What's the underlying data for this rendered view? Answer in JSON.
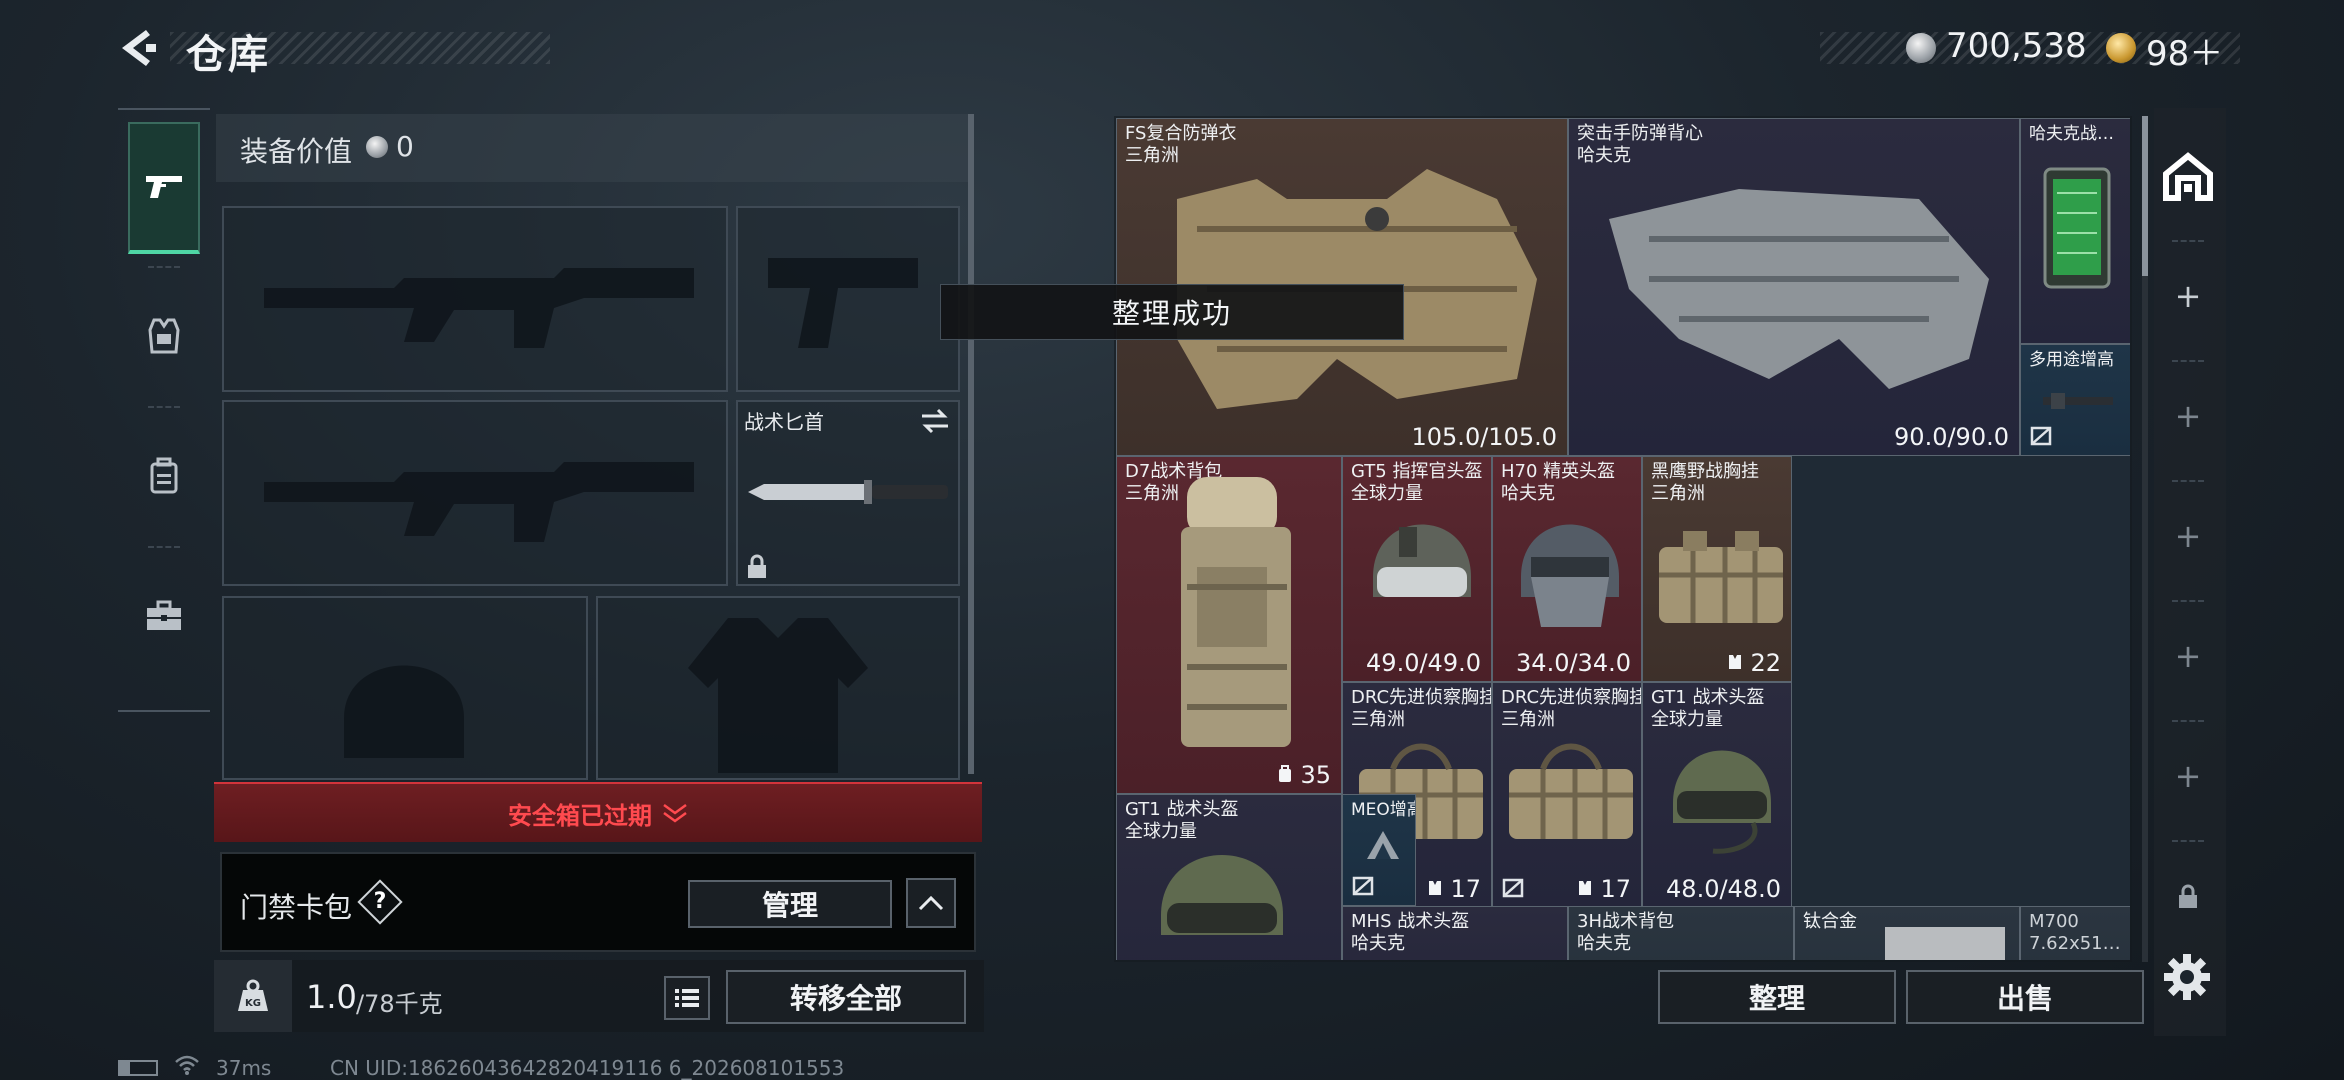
{
  "header": {
    "title": "仓库",
    "silver_amount": "700,538",
    "gold_amount": "98＋"
  },
  "sidenav": {
    "items": [
      {
        "icon": "pistol-icon",
        "active": true
      },
      {
        "icon": "armor-vest-icon",
        "active": false
      },
      {
        "icon": "backpack-icon",
        "active": false
      },
      {
        "icon": "briefcase-icon",
        "active": false
      }
    ]
  },
  "equipment": {
    "value_label": "装备价值",
    "value": "0",
    "knife_label": "战术匕首"
  },
  "safebox": {
    "warning": "安全箱已过期"
  },
  "keycard": {
    "label": "门禁卡包",
    "help": "?",
    "manage_label": "管理"
  },
  "weight": {
    "current": "1.0",
    "max": "/78千克",
    "transfer_label": "转移全部"
  },
  "toast": "整理成功",
  "grid": {
    "items": [
      {
        "name": "FS复合防弹衣",
        "sub": "三角洲",
        "value": "105.0/105.0"
      },
      {
        "name": "突击手防弹背心",
        "sub": "哈夫克",
        "value": "90.0/90.0"
      },
      {
        "name": "哈夫克战…",
        "sub": ""
      },
      {
        "name": "多用途增高",
        "sub": ""
      },
      {
        "name": "D7战术背包",
        "sub": "三角洲",
        "badge": "35"
      },
      {
        "name": "GT5 指挥官头盔",
        "sub": "全球力量",
        "value": "49.0/49.0"
      },
      {
        "name": "H70 精英头盔",
        "sub": "哈夫克",
        "value": "34.0/34.0"
      },
      {
        "name": "黑鹰野战胸挂",
        "sub": "三角洲",
        "badge": "22"
      },
      {
        "name": "DRC先进侦察胸挂",
        "sub": "三角洲",
        "badge": "17"
      },
      {
        "name": "DRC先进侦察胸挂",
        "sub": "三角洲",
        "badge": "17"
      },
      {
        "name": "GT1 战术头盔",
        "sub": "全球力量",
        "value": "48.0/48.0"
      },
      {
        "name": "GT1 战术头盔",
        "sub": "全球力量"
      },
      {
        "name": "MEO增高架",
        "sub": ""
      },
      {
        "name": "MHS 战术头盔",
        "sub": "哈夫克"
      },
      {
        "name": "3H战术背包",
        "sub": "哈夫克"
      },
      {
        "name": "钛合金",
        "sub": ""
      },
      {
        "name": "M700",
        "sub": "7.62x51…"
      }
    ]
  },
  "actions": {
    "sort_label": "整理",
    "sell_label": "出售"
  },
  "status": {
    "ping": "37ms",
    "uid": "CN UID:18626043642820419116 6_202608101553"
  }
}
